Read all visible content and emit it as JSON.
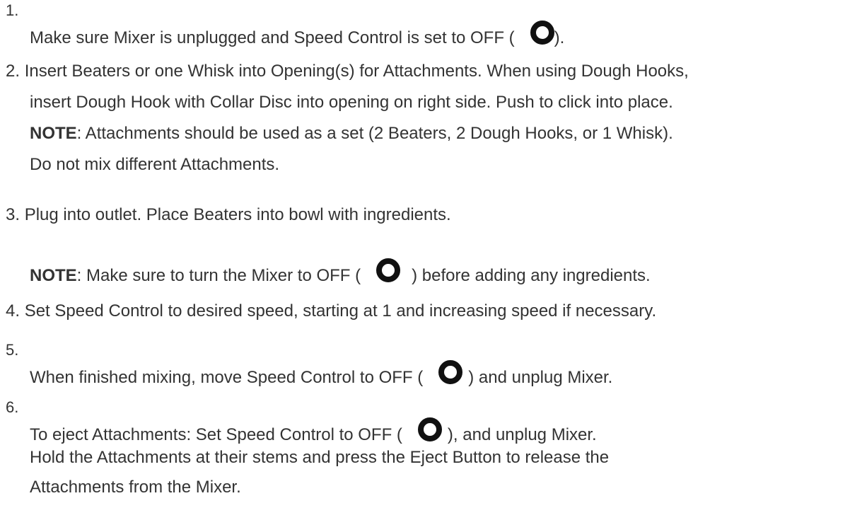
{
  "steps": [
    {
      "num": "1.",
      "text_before": "Make sure Mixer is unplugged and Speed Control is set to OFF (",
      "text_after": ")."
    },
    {
      "num": "2.",
      "line1": "Insert Beaters or one Whisk into Opening(s) for Attachments. When using Dough Hooks,",
      "line2": "insert Dough Hook with Collar Disc into opening on right side. Push to click into place.",
      "note_label": "NOTE",
      "note_line1": ": Attachments should be used as a set (2 Beaters, 2 Dough Hooks, or 1 Whisk).",
      "note_line2": "Do not mix different Attachments."
    },
    {
      "num": "3.",
      "line1": "Plug into outlet. Place Beaters into bowl with ingredients.",
      "note_label": "NOTE",
      "note_before": ": Make sure to turn the Mixer to OFF (",
      "note_after": ") before adding any ingredients."
    },
    {
      "num": "4.",
      "line1": "Set Speed Control to desired speed, starting at 1 and increasing speed if necessary."
    },
    {
      "num": "5.",
      "text_before": "When finished mixing, move Speed Control to OFF (",
      "text_after": ") and unplug Mixer."
    },
    {
      "num": "6.",
      "text_before": "To eject Attachments: Set Speed Control to OFF (",
      "text_after": "), and unplug Mixer.",
      "line2": "Hold the Attachments at their stems and press the Eject Button to release the",
      "line3": "Attachments from the Mixer."
    }
  ],
  "off_icon": "off-symbol-icon"
}
